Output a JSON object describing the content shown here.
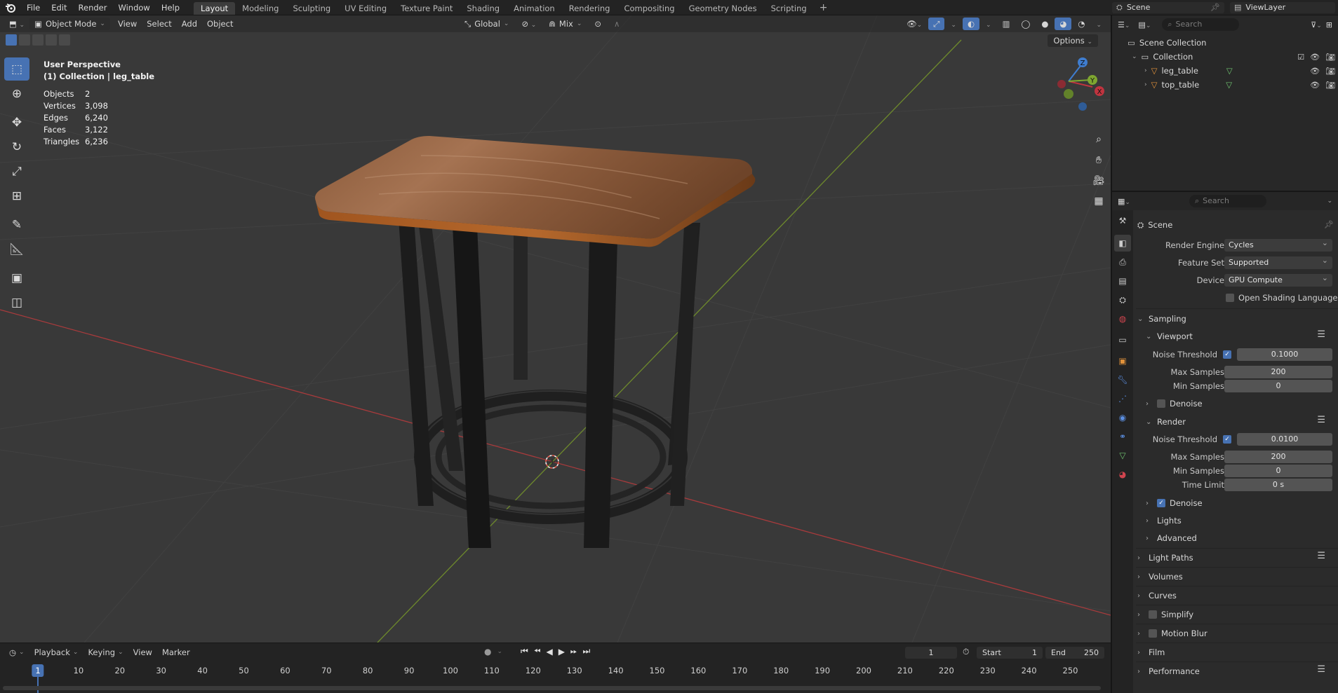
{
  "topbar": {
    "menus": [
      "File",
      "Edit",
      "Render",
      "Window",
      "Help"
    ],
    "workspaces": [
      "Layout",
      "Modeling",
      "Sculpting",
      "UV Editing",
      "Texture Paint",
      "Shading",
      "Animation",
      "Rendering",
      "Compositing",
      "Geometry Nodes",
      "Scripting"
    ],
    "active_workspace": "Layout",
    "add_tab": "+",
    "scene_name": "Scene",
    "view_layer": "ViewLayer"
  },
  "viewport": {
    "mode": "Object Mode",
    "menus": [
      "View",
      "Select",
      "Add",
      "Object"
    ],
    "transform_orientation": "Global",
    "snap_mode": "Mix",
    "options_label": "Options",
    "overlay": {
      "perspective": "User Perspective",
      "collection_path": "(1) Collection | leg_table",
      "stats": [
        {
          "key": "Objects",
          "value": "2"
        },
        {
          "key": "Vertices",
          "value": "3,098"
        },
        {
          "key": "Edges",
          "value": "6,240"
        },
        {
          "key": "Faces",
          "value": "3,122"
        },
        {
          "key": "Triangles",
          "value": "6,236"
        }
      ]
    },
    "gizmo_axes": {
      "x": "X",
      "y": "Y",
      "z": "Z"
    },
    "colors": {
      "x_axis": "#c0343f",
      "y_axis": "#7ea630",
      "z_axis": "#3f7dcf",
      "select": "#4772b3"
    }
  },
  "timeline": {
    "menus": [
      "Playback",
      "Keying",
      "View",
      "Marker"
    ],
    "current_frame": "1",
    "start_label": "Start",
    "start": "1",
    "end_label": "End",
    "end": "250",
    "ticks": [
      "10",
      "20",
      "30",
      "40",
      "50",
      "60",
      "70",
      "80",
      "90",
      "100",
      "110",
      "120",
      "130",
      "140",
      "150",
      "160",
      "170",
      "180",
      "190",
      "200",
      "210",
      "220",
      "230",
      "240",
      "250"
    ]
  },
  "outliner": {
    "search_placeholder": "Search",
    "scene_collection": "Scene Collection",
    "collection": "Collection",
    "objects": [
      "leg_table",
      "top_table"
    ]
  },
  "properties": {
    "search_placeholder": "Search",
    "context": "Scene",
    "render_engine_label": "Render Engine",
    "render_engine": "Cycles",
    "feature_set_label": "Feature Set",
    "feature_set": "Supported",
    "device_label": "Device",
    "device": "GPU Compute",
    "osl_label": "Open Shading Language",
    "sampling": "Sampling",
    "viewport": "Viewport",
    "noise_threshold_label": "Noise Threshold",
    "viewport_noise_threshold": "0.1000",
    "max_samples_label": "Max Samples",
    "viewport_max_samples": "200",
    "min_samples_label": "Min Samples",
    "viewport_min_samples": "0",
    "denoise_label": "Denoise",
    "render": "Render",
    "render_noise_threshold": "0.0100",
    "render_max_samples": "200",
    "render_min_samples": "0",
    "time_limit_label": "Time Limit",
    "time_limit": "0 s",
    "lights": "Lights",
    "advanced": "Advanced",
    "light_paths": "Light Paths",
    "volumes": "Volumes",
    "curves": "Curves",
    "simplify": "Simplify",
    "motion_blur": "Motion Blur",
    "film": "Film",
    "performance": "Performance"
  }
}
